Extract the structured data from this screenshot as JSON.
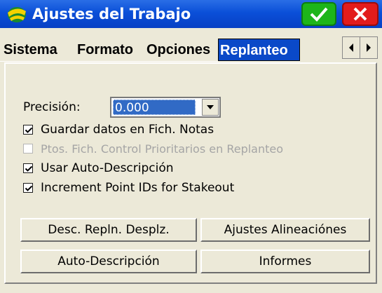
{
  "window": {
    "title": "Ajustes del Trabajo",
    "ok_icon": "checkmark-icon",
    "close_icon": "close-icon"
  },
  "tabs": [
    {
      "label": "Sistema",
      "active": false
    },
    {
      "label": "Formato",
      "active": false
    },
    {
      "label": "Opciones",
      "active": false
    },
    {
      "label": "Replanteo",
      "active": true
    }
  ],
  "tab_scroll": {
    "left_icon": "arrow-left-icon",
    "right_icon": "arrow-right-icon"
  },
  "precision": {
    "label": "Precisión:",
    "value": "0.000"
  },
  "checkboxes": [
    {
      "label": "Guardar datos en Fich. Notas",
      "checked": true,
      "enabled": true
    },
    {
      "label": "Ptos. Fich. Control Prioritarios en Replanteo",
      "checked": false,
      "enabled": false
    },
    {
      "label": "Usar Auto-Descripción",
      "checked": true,
      "enabled": true
    },
    {
      "label": "Increment Point IDs for Stakeout",
      "checked": true,
      "enabled": true
    }
  ],
  "buttons": {
    "desc_repln": "Desc. Repln. Desplz.",
    "ajustes_alineaciones": "Ajustes Alineaciónes",
    "auto_descripcion": "Auto-Descripción",
    "informes": "Informes"
  },
  "colors": {
    "titlebar": "#0a4fd8",
    "active_tab": "#0a49c8",
    "ok_button": "#1db51a",
    "close_button": "#e21c1c",
    "background": "#ece9d8"
  }
}
